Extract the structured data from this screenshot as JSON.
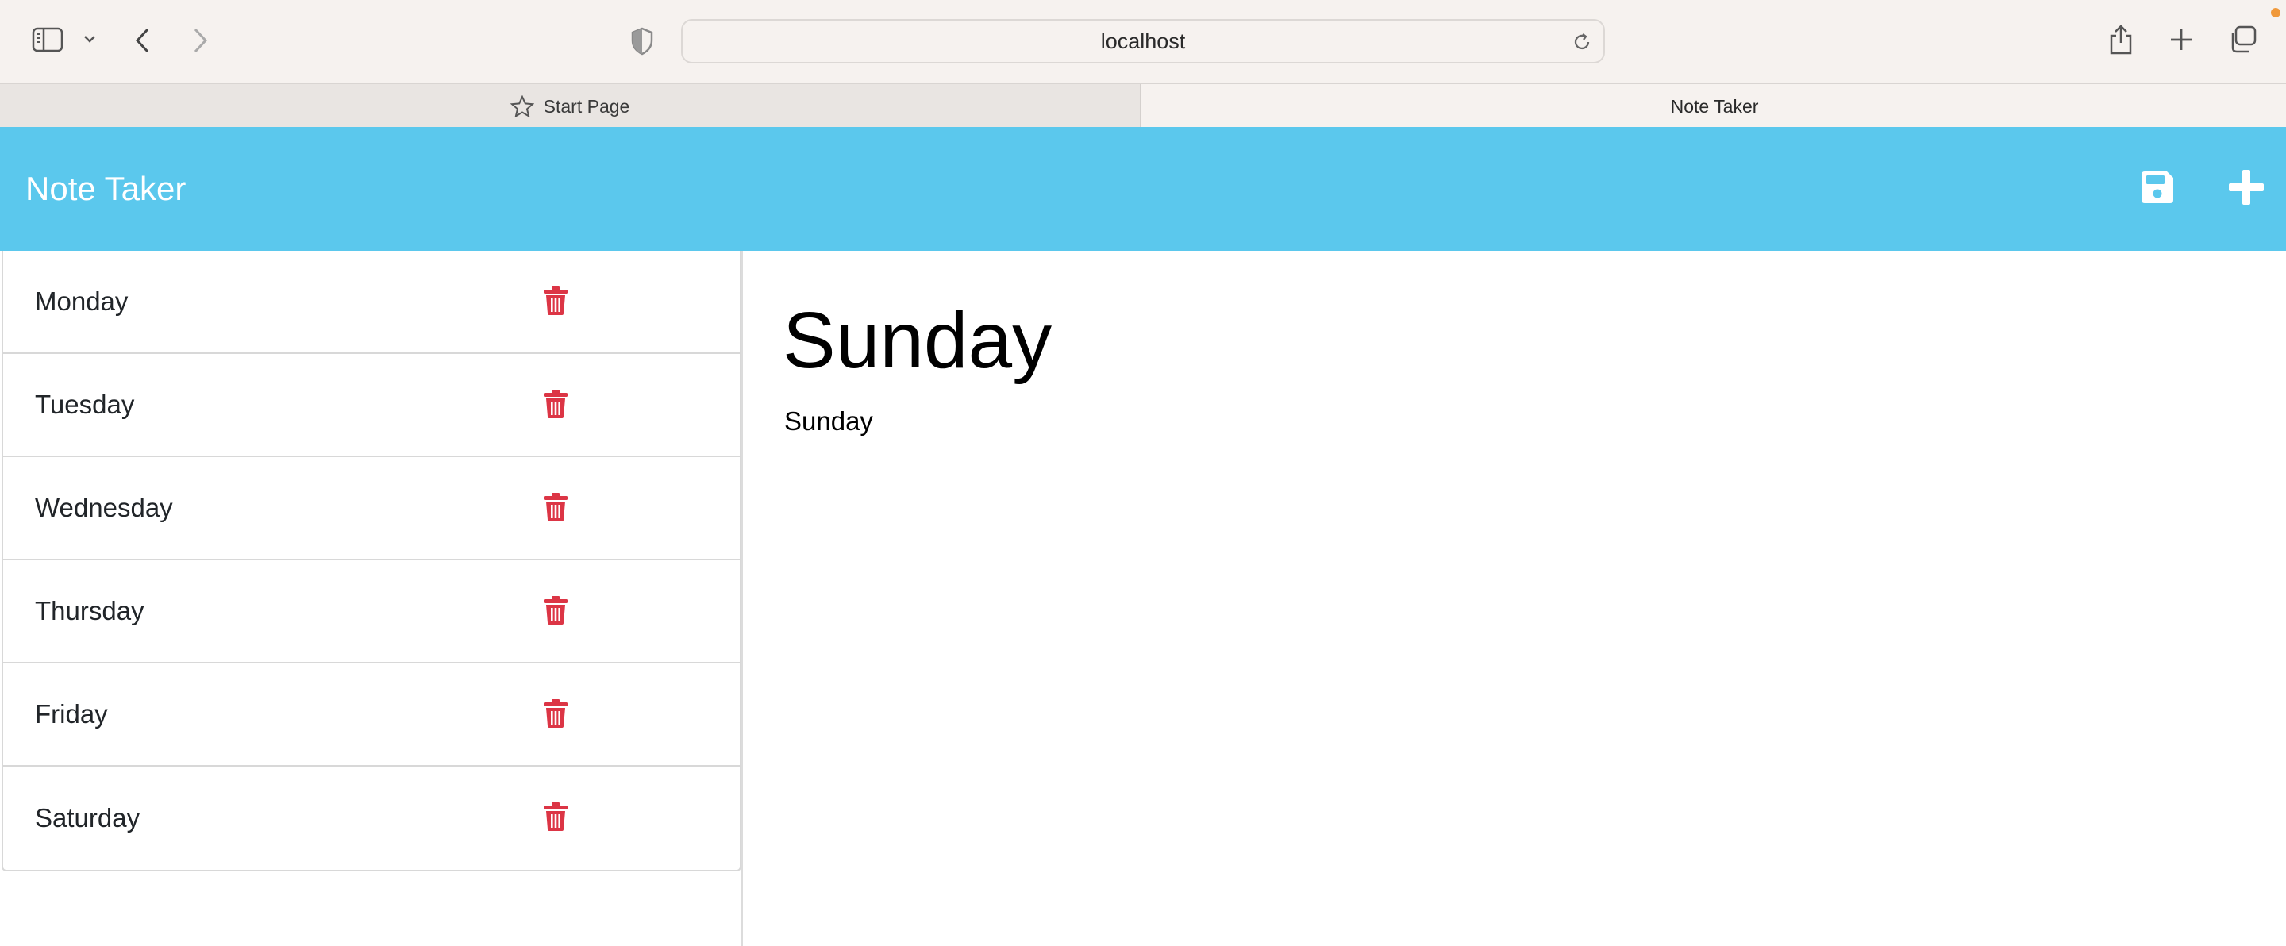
{
  "browser": {
    "url": "localhost",
    "tabs": [
      {
        "label": "Start Page",
        "active": false
      },
      {
        "label": "Note Taker",
        "active": true
      }
    ]
  },
  "app": {
    "title": "Note Taker",
    "accent_color": "#5bc8ed",
    "delete_color": "#dc3545"
  },
  "notes": [
    {
      "title": "Monday"
    },
    {
      "title": "Tuesday"
    },
    {
      "title": "Wednesday"
    },
    {
      "title": "Thursday"
    },
    {
      "title": "Friday"
    },
    {
      "title": "Saturday"
    }
  ],
  "active_note": {
    "title": "Sunday",
    "text": "Sunday"
  }
}
